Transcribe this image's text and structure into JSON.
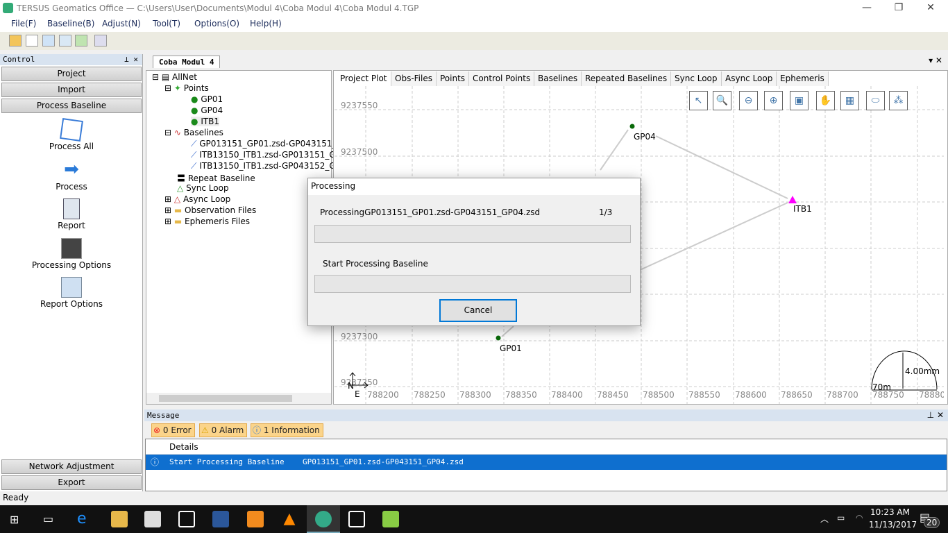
{
  "window": {
    "title": "TERSUS Geomatics Office — C:\\Users\\User\\Documents\\Modul 4\\Coba Modul 4\\Coba Modul 4.TGP"
  },
  "menu": [
    "File(F)",
    "Baseline(B)",
    "Adjust(N)",
    "Tool(T)",
    "Options(O)",
    "Help(H)"
  ],
  "control": {
    "title": "Control",
    "sections": {
      "project": "Project",
      "import": "Import",
      "process_baseline": "Process Baseline",
      "network_adjustment": "Network Adjustment",
      "export": "Export"
    },
    "tools": [
      "Process All",
      "Process",
      "Report",
      "Processing Options",
      "Report Options"
    ]
  },
  "document_tab": "Coba Modul 4",
  "tree": {
    "root": "AllNet",
    "points": "Points",
    "point_items": [
      "GP01",
      "GP04",
      "ITB1"
    ],
    "baselines": "Baselines",
    "baseline_items": [
      "GP013151_GP01.zsd-GP043151_",
      "ITB13150_ITB1.zsd-GP013151_G",
      "ITB13150_ITB1.zsd-GP043152_G"
    ],
    "others": [
      "Repeat Baseline",
      "Sync Loop",
      "Async Loop",
      "Observation Files",
      "Ephemeris Files"
    ]
  },
  "plot_tabs": [
    "Project Plot",
    "Obs-Files",
    "Points",
    "Control Points",
    "Baselines",
    "Repeated Baselines",
    "Sync Loop",
    "Async Loop",
    "Ephemeris"
  ],
  "plot": {
    "y_ticks": [
      "9237550",
      "9237500",
      "9237300",
      "9237250"
    ],
    "x_ticks": [
      "788200",
      "788250",
      "788300",
      "788350",
      "788400",
      "788450",
      "788500",
      "788550",
      "788600",
      "788650",
      "788700",
      "788750",
      "78880"
    ],
    "points": [
      "GP04",
      "ITB1",
      "GP01"
    ],
    "north": "N",
    "east": "E",
    "scale_mm": "4.00mm",
    "scale_m": "70m",
    "tools": [
      "pointer-icon",
      "zoom-window-icon",
      "zoom-out-icon",
      "zoom-in-icon",
      "zoom-extent-icon",
      "pan-hand-icon",
      "grid-icon",
      "error-ellipse-icon",
      "network-icon"
    ]
  },
  "dialog": {
    "title": "Processing",
    "file_text": "ProcessingGP013151_GP01.zsd-GP043151_GP04.zsd",
    "count": "1/3",
    "step_text": "Start Processing Baseline",
    "cancel": "Cancel",
    "progress1": 0,
    "progress2": 0
  },
  "message": {
    "title": "Message",
    "error": "0 Error",
    "alarm": "0 Alarm",
    "info": "1 Information",
    "col_details": "Details",
    "rows": [
      {
        "text": "Start Processing Baseline    GP013151_GP01.zsd-GP043151_GP04.zsd"
      }
    ]
  },
  "status": "Ready",
  "taskbar": {
    "time": "10:23 AM",
    "date": "11/13/2017",
    "notifications": "20"
  }
}
